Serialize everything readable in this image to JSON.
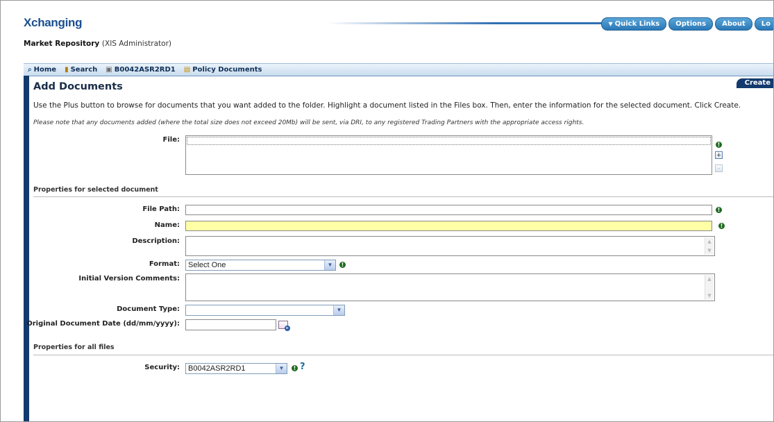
{
  "header": {
    "brand": "Xchanging",
    "repository_name": "Market Repository",
    "role": "(XIS Administrator)",
    "buttons": [
      "Quick Links",
      "Options",
      "About",
      "Lo"
    ]
  },
  "nav": {
    "items": [
      {
        "label": "Home",
        "icon": "home-icon"
      },
      {
        "label": "Search",
        "icon": "search-icon"
      },
      {
        "label": "B0042ASR2RD1",
        "icon": "folder-icon"
      },
      {
        "label": "Policy Documents",
        "icon": "documents-icon"
      }
    ]
  },
  "action_tab": "Create",
  "page": {
    "title": "Add Documents",
    "instructions": "Use the Plus button to browse for documents that you want added to the folder. Highlight a document listed in the Files box. Then, enter the information for the selected document. Click Create.",
    "note": "Please note that any documents added (where the total size does not exceed 20Mb) will be sent, via DRI, to any registered Trading Partners with the appropriate access rights."
  },
  "form": {
    "file_label": "File:",
    "selected_section": "Properties for selected document",
    "file_path_label": "File Path:",
    "file_path_value": "",
    "name_label": "Name:",
    "name_value": "",
    "description_label": "Description:",
    "format_label": "Format:",
    "format_value": "Select One",
    "comments_label": "Initial Version Comments:",
    "doc_type_label": "Document Type:",
    "doc_type_value": "",
    "orig_date_label": "Original Document Date (dd/mm/yyyy):",
    "orig_date_value": "",
    "all_files_section": "Properties for all files",
    "security_label": "Security:",
    "security_value": "B0042ASR2RD1",
    "help_glyph": "?"
  },
  "colors": {
    "brand": "#1a4f8f",
    "nav_dark": "#123a6e",
    "required_highlight": "#ffffa6",
    "required_icon": "#1f6b1f"
  }
}
